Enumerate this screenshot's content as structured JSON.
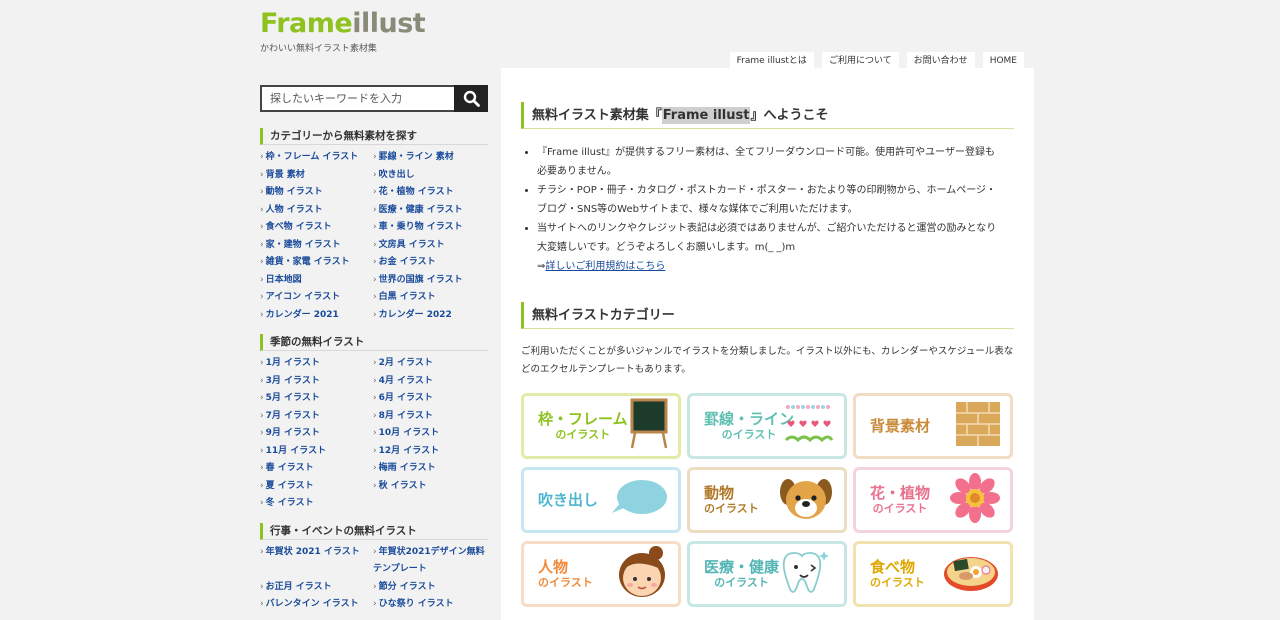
{
  "logo": {
    "part1": "Frame",
    "part2": "illust",
    "tagline": "かわいい無料イラスト素材集"
  },
  "topnav": [
    "Frame illustとは",
    "ご利用について",
    "お問い合わせ",
    "HOME"
  ],
  "search": {
    "placeholder": "探したいキーワードを入力"
  },
  "sidebar": {
    "categories": {
      "heading": "カテゴリーから無料素材を探す",
      "items": [
        "枠・フレーム イラスト",
        "罫線・ライン 素材",
        "背景 素材",
        "吹き出し",
        "動物 イラスト",
        "花・植物 イラスト",
        "人物 イラスト",
        "医療・健康 イラスト",
        "食べ物 イラスト",
        "車・乗り物 イラスト",
        "家・建物 イラスト",
        "文房具 イラスト",
        "雑貨・家電 イラスト",
        "お金 イラスト",
        "日本地図",
        "世界の国旗 イラスト",
        "アイコン イラスト",
        "白黒 イラスト",
        "カレンダー 2021",
        "カレンダー 2022"
      ]
    },
    "seasons": {
      "heading": "季節の無料イラスト",
      "items": [
        "1月 イラスト",
        "2月 イラスト",
        "3月 イラスト",
        "4月 イラスト",
        "5月 イラスト",
        "6月 イラスト",
        "7月 イラスト",
        "8月 イラスト",
        "9月 イラスト",
        "10月 イラスト",
        "11月 イラスト",
        "12月 イラスト",
        "春 イラスト",
        "梅雨 イラスト",
        "夏 イラスト",
        "秋 イラスト",
        "冬 イラスト"
      ]
    },
    "events": {
      "heading": "行事・イベントの無料イラスト",
      "items": [
        "年賀状 2021 イラスト",
        "年賀状2021デザイン無料テンプレート",
        "お正月 イラスト",
        "節分 イラスト",
        "バレンタイン イラスト",
        "ひな祭り イラスト"
      ]
    }
  },
  "main": {
    "welcome_prefix": "無料イラスト素材集『",
    "welcome_highlight": "Frame illust",
    "welcome_suffix": "』へようこそ",
    "intro": [
      "『Frame illust』が提供するフリー素材は、全てフリーダウンロード可能。使用許可やユーザー登録も必要ありません。",
      "チラシ・POP・冊子・カタログ・ポストカード・ポスター・おたより等の印刷物から、ホームページ・ブログ・SNS等のWebサイトまで、様々な媒体でご利用いただけます。",
      "当サイトへのリンクやクレジット表記は必須ではありませんが、ご紹介いただけると運営の励みとなり大変嬉しいです。どうぞよろしくお願いします。m(_ _)m"
    ],
    "terms_arrow": "⇒",
    "terms_link": "詳しいご利用規約はこちら",
    "category_heading": "無料イラストカテゴリー",
    "category_desc": "ご利用いただくことが多いジャンルでイラストを分類しました。イラスト以外にも、カレンダーやスケジュール表などのエクセルテンプレートもあります。",
    "cards": [
      {
        "title": "枠・フレーム",
        "sub": "のイラスト",
        "icon": "chalkboard-icon",
        "color": "#8dc21f",
        "border": "#e3eba8"
      },
      {
        "title": "罫線・ライン",
        "sub": "のイラスト",
        "icon": "dotted-line-icon",
        "color": "#5fbfb0",
        "border": "#c9e7e2"
      },
      {
        "title": "背景素材",
        "sub": "",
        "icon": "brick-pattern-icon",
        "color": "#c98a3a",
        "border": "#f1dcc3"
      },
      {
        "title": "吹き出し",
        "sub": "",
        "icon": "speech-bubble-icon",
        "color": "#4fb8cf",
        "border": "#c5e7ef"
      },
      {
        "title": "動物",
        "sub": "のイラスト",
        "icon": "dog-icon",
        "color": "#b07a2a",
        "border": "#ecdcc0"
      },
      {
        "title": "花・植物",
        "sub": "のイラスト",
        "icon": "flower-icon",
        "color": "#e8708d",
        "border": "#f5d3dc"
      },
      {
        "title": "人物",
        "sub": "のイラスト",
        "icon": "girl-face-icon",
        "color": "#f08a3a",
        "border": "#f7dcc8"
      },
      {
        "title": "医療・健康",
        "sub": "のイラスト",
        "icon": "tooth-icon",
        "color": "#55b5b5",
        "border": "#c7e6e6"
      },
      {
        "title": "食べ物",
        "sub": "のイラスト",
        "icon": "ramen-icon",
        "color": "#e0a800",
        "border": "#f1e2b0"
      }
    ]
  }
}
